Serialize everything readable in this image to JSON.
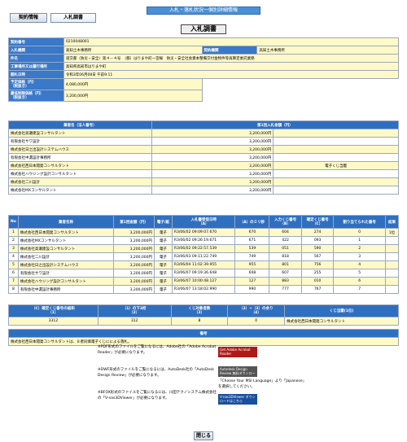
{
  "topbar": "入札・落札状況一個別詳細情報",
  "tabs": [
    "契約情報",
    "入札調書"
  ],
  "page_title": "入札調書",
  "info": [
    {
      "label": "契約番号",
      "value": "0210048001"
    },
    {
      "label": "入札機関",
      "value": "高知土木事務所",
      "label2": "契約機関",
      "value2": "高知土木事務所"
    },
    {
      "label": "件名",
      "value": "道交都（防災・安全）第４－４号　（都）はりまや町一宮線　防災・安全社会資本整備交付金物件等再算定委託業務"
    },
    {
      "label": "工事場所又は履行場所",
      "value": "高知県高知市はりまや町"
    },
    {
      "label": "開札日時",
      "value": "令和3年06月08日 午前9:11"
    },
    {
      "label": "予定価格（円）\n（税抜き）",
      "value": "4,080,000円"
    },
    {
      "label": "最低制限価格（円）\n（税抜き）",
      "value": "3,200,000円"
    }
  ],
  "round_headers": [
    "業者名（法人番号）",
    "第1回入札金額（円）"
  ],
  "round": [
    {
      "name": "株式会社高瀬建設コンサルタント",
      "amount": "3,200,000円",
      "note": ""
    },
    {
      "name": "有限会社サワ設計",
      "amount": "3,200,000円",
      "note": ""
    },
    {
      "name": "株式会社日之出設計システムハウス",
      "amount": "3,200,000円",
      "note": ""
    },
    {
      "name": "有限会社中濃設計事務所",
      "amount": "3,200,000円",
      "note": ""
    },
    {
      "name": "株式会社西日本開発コンサルタント",
      "amount": "3,200,000円",
      "note": "電子くじ当籤"
    },
    {
      "name": "株式会社ハウジング設計コンサルタント",
      "amount": "3,200,000円",
      "note": ""
    },
    {
      "name": "株式会社二川設計",
      "amount": "3,200,000円",
      "note": ""
    },
    {
      "name": "株式会社MXコンサルタント",
      "amount": "3,200,000円",
      "note": ""
    }
  ],
  "lottery_headers": [
    "No",
    "業者名称",
    "第1回金額（円）",
    "電子/紙",
    "入札書受信日時\n（A）",
    "（A）のミリ秒",
    "入力くじ番号\n（B）",
    "確定くじ番号\n（C）",
    "割り当てられた番号",
    "結果"
  ],
  "lottery": [
    [
      "1",
      "株式会社西日本開発コンサルタント",
      "3,200,000円",
      "電子",
      "R3/06/02 09:09:07.670",
      "670",
      "604",
      "274",
      "0",
      "1位"
    ],
    [
      "2",
      "株式会社MXコンサルタント",
      "3,200,000円",
      "電子",
      "R3/06/02 09:26:19.671",
      "671",
      "422",
      "093",
      "1",
      ""
    ],
    [
      "3",
      "株式会社高瀬建設コンサルタント",
      "3,200,000円",
      "電子",
      "R3/06/02 09:22:57.539",
      "539",
      "051",
      "590",
      "2",
      ""
    ],
    [
      "4",
      "株式会社二川設計",
      "3,200,000円",
      "電子",
      "R3/06/03 09:11:22.749",
      "749",
      "818",
      "567",
      "3",
      ""
    ],
    [
      "5",
      "株式会社日之出設計システムハウス",
      "3,200,000円",
      "電子",
      "R3/06/04 11:02:39.955",
      "955",
      "801",
      "756",
      "4",
      ""
    ],
    [
      "6",
      "有限会社サワ設計",
      "3,200,000円",
      "電子",
      "R3/06/07 09:19:36.648",
      "648",
      "607",
      "255",
      "5",
      ""
    ],
    [
      "7",
      "株式会社ハウジング設計コンサルタント",
      "3,200,000円",
      "電子",
      "R3/06/07 10:00:48.127",
      "127",
      "883",
      "010",
      "6",
      ""
    ],
    [
      "8",
      "有限会社中濃設計事務所",
      "3,200,000円",
      "電子",
      "R3/06/07 13:18:02.990",
      "990",
      "777",
      "767",
      "7",
      ""
    ]
  ],
  "summary_headers": [
    "（C）確定くじ番号の総和\n（1）",
    "（1）の下3桁\n（2）",
    "くじ対象者数\n（3）",
    "（2）÷（3）の余り\n（4）",
    "くじ当籤(1位)"
  ],
  "summary": [
    "3312",
    "312",
    "8",
    "0",
    "株式会社西日本開発コンサルタント"
  ],
  "remarks_header": "備考",
  "remarks": "株式会社西日本開発コンサルタントは、８者同価電子くじにによる落札。",
  "notes": [
    "※PDF形式のファイルをご覧になるには、Adobe社の「Adobe Acrobat Reader」が必要になります。",
    "※DWF形式のファイルをご覧になるには、AutoDesk社の「AutoDesk Design Review」が必要になります。",
    "※BFOX形式のファイルをご覧になるには、川田テクノシステム株式会社の「V-nas3DViewer」が必要になります。"
  ],
  "badges": [
    "Get Adobe Acrobat Reader",
    "Autodesk Design Review 無料ダウンロード",
    "V-nas3DViewer ダウンロードはこちら"
  ],
  "msi_note": "「Choose Your MSI Language」より「Japanese」を選択してください。",
  "close_label": "閉じる"
}
